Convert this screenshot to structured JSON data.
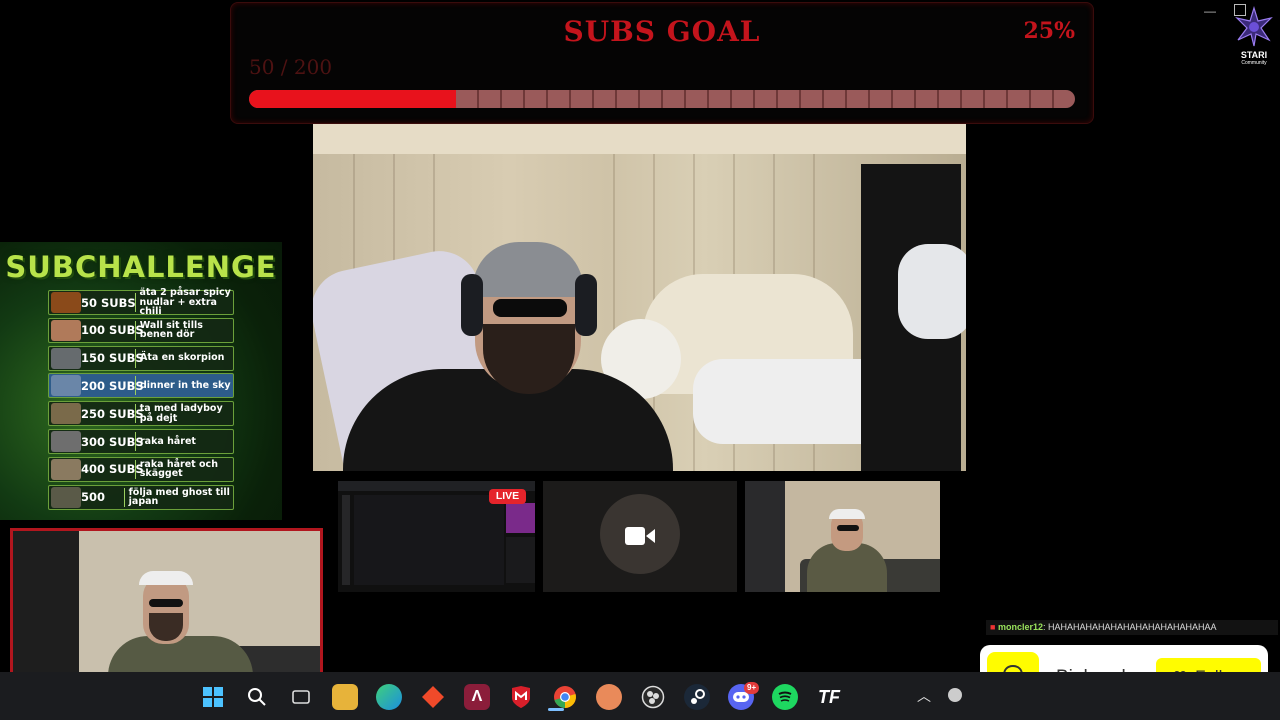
{
  "subs_goal": {
    "title": "SUBS GOAL",
    "percent_label": "25%",
    "count_label": "50 / 200",
    "progress_fraction": 0.25
  },
  "subchallenge": {
    "title": "SUBCHALLENGE",
    "items": [
      {
        "subs": "50 SUBS",
        "text": "äta 2 påsar spicy nudlar + extra chili"
      },
      {
        "subs": "100 SUBS",
        "text": "Wall sit tills benen dör"
      },
      {
        "subs": "150 SUBS",
        "text": "Äta en skorpion"
      },
      {
        "subs": "200 SUBS",
        "text": "dinner in the sky"
      },
      {
        "subs": "250 SUBS",
        "text": "ta med ladyboy på dejt"
      },
      {
        "subs": "300 SUBS",
        "text": "raka håret"
      },
      {
        "subs": "400 SUBS",
        "text": "raka håret och skägget"
      },
      {
        "subs": "500",
        "text": "följa med ghost till japan"
      }
    ]
  },
  "live_badge": "LIVE",
  "chat": {
    "user": "moncler12",
    "message": ": HAHAHAHAHAHAHAHAHAHAHAHAHAA"
  },
  "follow_widget": {
    "name": "Bigheerb",
    "button_label": "Follow",
    "accent": "#fffc00"
  },
  "brand": {
    "name": "STARI",
    "sub": "Community"
  },
  "taskbar": {
    "icons": [
      "windows-start-icon",
      "search-icon",
      "task-view-icon",
      "file-explorer-icon",
      "edge-icon",
      "diamond-app-icon",
      "affinity-icon",
      "mcafee-icon",
      "chrome-icon",
      "spiral-app-icon",
      "obs-icon",
      "steam-icon",
      "discord-icon",
      "spotify-icon",
      "tf-app-icon"
    ],
    "discord_badge": "9+",
    "tf_label": "TF"
  },
  "colors": {
    "goal_red": "#c4141c",
    "bar_fill": "#e8121c"
  }
}
